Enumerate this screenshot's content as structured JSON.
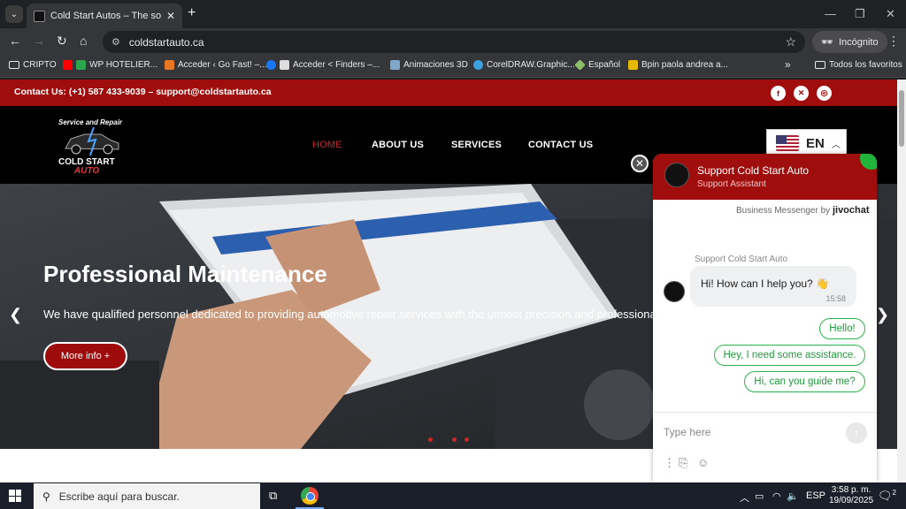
{
  "browser": {
    "tab_title": "Cold Start Autos – The solution",
    "tab_close": "✕",
    "new_tab": "+",
    "url": "coldstartauto.ca",
    "profile": "Incógnito",
    "window_controls": [
      "—",
      "❐",
      "✕"
    ],
    "bookmarks": [
      {
        "label": "CRIPTO",
        "icon": "folder-icon"
      },
      {
        "label": "WP HOTELIER...",
        "icon": "youtube-icon"
      },
      {
        "label": "Acceder ‹ Go Fast! –...",
        "icon": "orange-site-icon"
      },
      {
        "label": "Acceder < Finders –...",
        "icon": "facebook-icon"
      },
      {
        "label": "Animaciones 3D",
        "icon": "image-icon"
      },
      {
        "label": "CorelDRAW.Graphic...",
        "icon": "coreldraw-icon"
      },
      {
        "label": "Español",
        "icon": "diamond-icon"
      },
      {
        "label": "Bpin paola andrea a...",
        "icon": "crown-icon"
      }
    ],
    "bookmarks_more": "»",
    "all_bookmarks": "Todos los favoritos"
  },
  "site": {
    "contact_line": "Contact Us: (+1) 587 433-9039 – support@coldstartauto.ca",
    "social": [
      {
        "name": "facebook-icon",
        "glyph": "f"
      },
      {
        "name": "x-icon",
        "glyph": "✕"
      },
      {
        "name": "instagram-icon",
        "glyph": "◎"
      }
    ],
    "logo_top": "Service and Repair",
    "logo_main": "COLD START",
    "logo_sub": "AUTO",
    "menu": [
      "HOME",
      "ABOUT US",
      "SERVICES",
      "CONTACT US"
    ],
    "lang_code": "EN",
    "hero_title": "Professional Maintenance",
    "hero_text": "We have qualified personnel dedicated to providing automotive repair services with the utmost precision and professionalism",
    "hero_button": "More info +"
  },
  "chat": {
    "name": "Support Cold Start Auto",
    "role": "Support Assistant",
    "business_prefix": "Business Messenger by",
    "business_brand": "jivochat",
    "agent_label": "Support Cold Start Auto",
    "agent_message": "Hi! How can I help you? 👋",
    "agent_time": "15:58",
    "quick_replies": [
      "Hello!",
      "Hey, I need some assistance.",
      "Hi, can you guide me?"
    ],
    "input_placeholder": "Type here"
  },
  "taskbar": {
    "search_placeholder": "Escribe aquí para buscar.",
    "language": "ESP",
    "time": "3:58 p. m.",
    "date": "19/09/2025",
    "notifications": "2"
  },
  "colors": {
    "brand_red": "#a00d0d",
    "quick_reply_green": "#29b34a"
  }
}
